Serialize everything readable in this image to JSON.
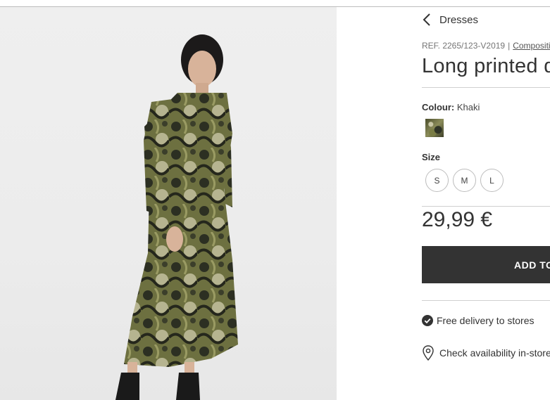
{
  "breadcrumb": {
    "back_icon": "chevron-left-icon",
    "label": "Dresses"
  },
  "product": {
    "reference": "REF. 2265/123-V2019",
    "separator": "|",
    "composition_link": "Composition",
    "title": "Long printed dress",
    "colour_label": "Colour:",
    "colour_value": "Khaki",
    "size_label": "Size",
    "sizes": [
      "S",
      "M",
      "L"
    ],
    "price": "29,99 €"
  },
  "cart": {
    "button_label": "ADD TO BAG",
    "button_icon": "shopping-bag-icon"
  },
  "services": {
    "delivery_icon": "check-circle-icon",
    "delivery_text": "Free delivery to stores",
    "availability_icon": "location-pin-icon",
    "availability_text": "Check availability in-store"
  },
  "colors": {
    "button_bg": "#333333",
    "text": "#333333",
    "dress_khaki": "#6b6d3a"
  }
}
